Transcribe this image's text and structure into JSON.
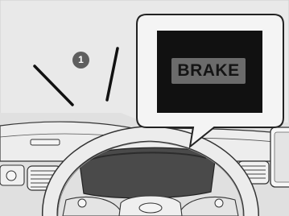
{
  "figure": {
    "callout_number": "1",
    "indicator_text": "BRAKE",
    "colors": {
      "background": "#e8e8e8",
      "display_screen": "#111111",
      "indicator_box": "#6b6b6b",
      "callout_badge": "#5f5f5f"
    }
  }
}
